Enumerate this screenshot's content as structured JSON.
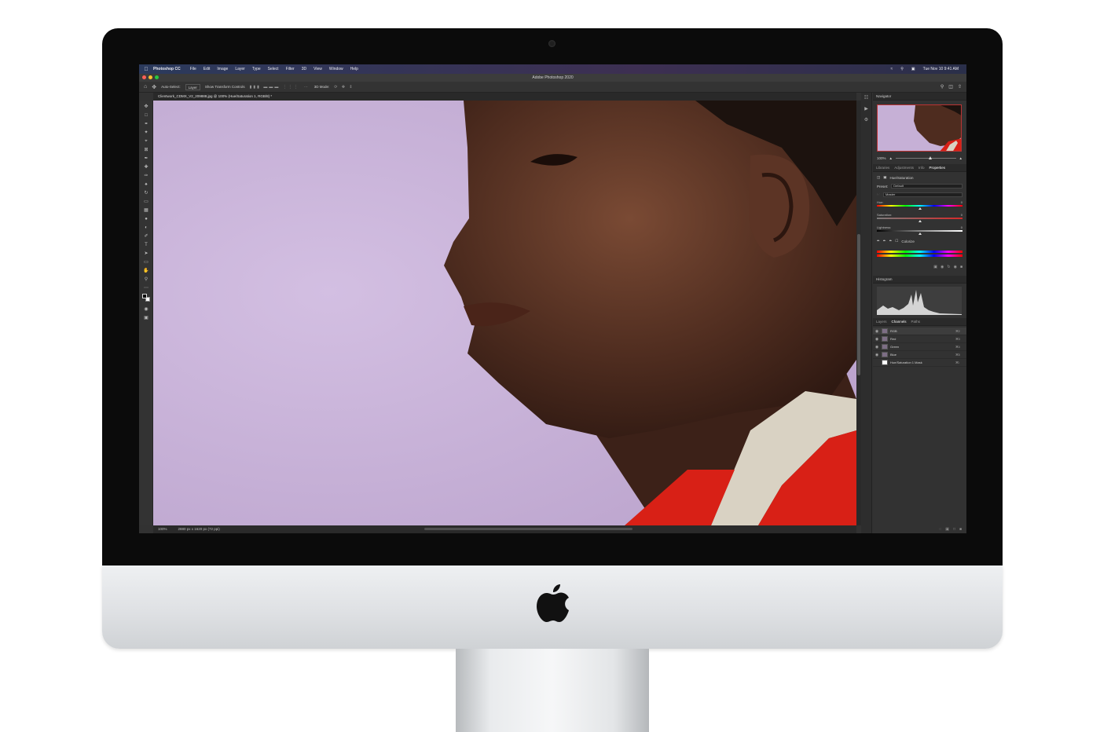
{
  "mac_menubar": {
    "app_name": "Photoshop CC",
    "menus": [
      "File",
      "Edit",
      "Image",
      "Layer",
      "Type",
      "Select",
      "Filter",
      "3D",
      "View",
      "Window",
      "Help"
    ],
    "date_time": "Tue Nov 10  9:41 AM"
  },
  "window": {
    "title": "Adobe Photoshop 2020"
  },
  "options_bar": {
    "auto_select_label": "Auto-Select:",
    "auto_select_value": "Layer",
    "transform_label": "Show Transform Controls",
    "mode_label": "3D Mode:"
  },
  "document": {
    "tab_title": "Clientwork_CDMX_V2_209888.jpg @ 100% (Hue/Saturation 1, RGB/8) *",
    "zoom": "100%",
    "dimensions": "2880 px x 1620 px (72 ppi)"
  },
  "panels": {
    "navigator": {
      "title": "Navigator",
      "zoom": "100%"
    },
    "tabs": [
      "Libraries",
      "Adjustments",
      "Info",
      "Properties"
    ],
    "properties": {
      "adjustment_name": "Hue/Saturation",
      "preset_label": "Preset:",
      "preset_value": "Default",
      "channel_value": "Master",
      "hue_label": "Hue:",
      "hue_value": "0",
      "saturation_label": "Saturation:",
      "saturation_value": "0",
      "lightness_label": "Lightness:",
      "lightness_value": "0",
      "colorize_label": "Colorize"
    },
    "histogram": {
      "title": "Histogram"
    },
    "layer_tabs": [
      "Layers",
      "Channels",
      "Paths"
    ],
    "channels": [
      {
        "name": "RGB",
        "key": "⌘2"
      },
      {
        "name": "Red",
        "key": "⌘3"
      },
      {
        "name": "Green",
        "key": "⌘4"
      },
      {
        "name": "Blue",
        "key": "⌘5"
      },
      {
        "name": "Hue/Saturation 1 Mask",
        "key": "⌘\\"
      }
    ]
  },
  "colors": {
    "wall": "#c6b0d6",
    "shirt_red": "#d82016",
    "skin": "#5a3424",
    "app_dark": "#323232"
  }
}
